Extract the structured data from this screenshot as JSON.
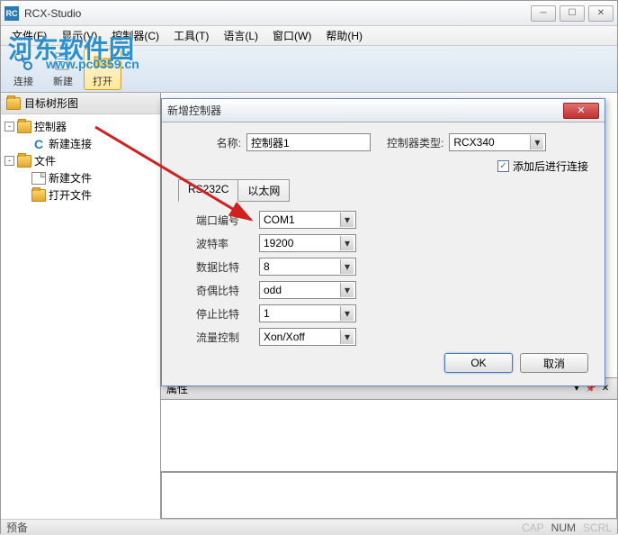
{
  "app": {
    "title": "RCX-Studio"
  },
  "watermark": {
    "text": "河东软件园",
    "url": "www.pc0359.cn"
  },
  "menu": {
    "file": "文件(F)",
    "view": "显示(V)",
    "controller": "控制器(C)",
    "tool": "工具(T)",
    "lang": "语言(L)",
    "window": "窗口(W)",
    "help": "帮助(H)"
  },
  "toolbar": {
    "connect": "连接",
    "new": "新建",
    "open": "打开"
  },
  "tree": {
    "header": "目标树形图",
    "controller": "控制器",
    "new_conn": "新建连接",
    "files": "文件",
    "new_file": "新建文件",
    "open_file": "打开文件"
  },
  "props": {
    "title": "属性"
  },
  "status": {
    "left": "预备",
    "cap": "CAP",
    "num": "NUM",
    "scrl": "SCRL"
  },
  "dialog": {
    "title": "新增控制器",
    "name_label": "名称:",
    "name_value": "控制器1",
    "type_label": "控制器类型:",
    "type_value": "RCX340",
    "connect_after": "添加后进行连接",
    "tab_rs232c": "RS232C",
    "tab_eth": "以太网",
    "port_label": "端口编号",
    "port_value": "COM1",
    "baud_label": "波特率",
    "baud_value": "19200",
    "databits_label": "数据比特",
    "databits_value": "8",
    "parity_label": "奇偶比特",
    "parity_value": "odd",
    "stopbits_label": "停止比特",
    "stopbits_value": "1",
    "flow_label": "流量控制",
    "flow_value": "Xon/Xoff",
    "ok": "OK",
    "cancel": "取消"
  }
}
